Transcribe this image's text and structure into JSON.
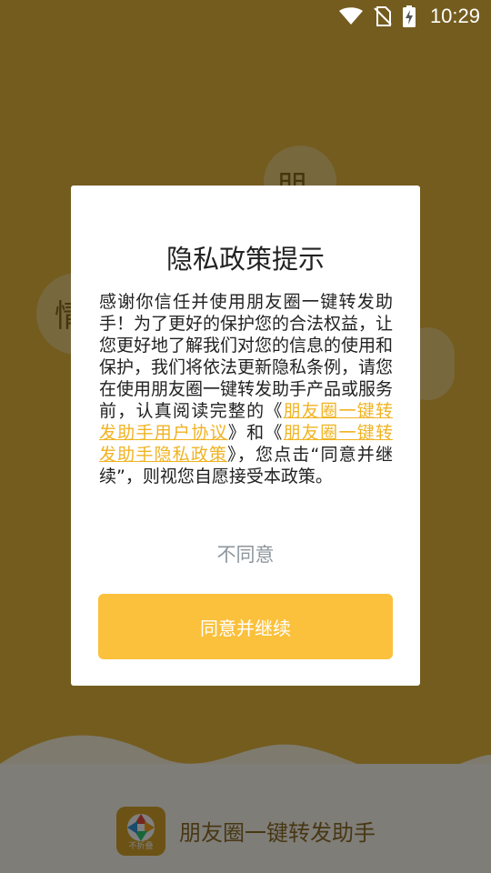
{
  "status_bar": {
    "time": "10:29",
    "icons": [
      "wifi-icon",
      "no-sim-icon",
      "battery-charging-icon"
    ]
  },
  "splash": {
    "app_name": "朋友圈一键转发助手",
    "icon_badge": "不折叠",
    "bubble_chars": [
      "朋",
      "情"
    ]
  },
  "dialog": {
    "title": "隐私政策提示",
    "body_part_1": "感谢你信任并使用朋友圈一键转发助手！为了更好的保护您的合法权益，让您更好地了解我们对您的信息的使用和保护，我们将依法更新隐私条例，请您在使用朋友圈一键转发助手产品或服务前，认真阅读完整的《",
    "user_agreement_link": "朋友圈一键转发助手用户协议",
    "body_part_2": "》和《",
    "privacy_policy_link": "朋友圈一键转发助手隐私政策",
    "body_part_3": "》，您点击“同意并继续”，则视您自愿接受本政策。",
    "decline_label": "不同意",
    "agree_label": "同意并继续"
  },
  "colors": {
    "splash_background": "#e7b93c",
    "accent": "#fbc13c",
    "link": "#f0b323",
    "decline_text": "#8d969c"
  }
}
